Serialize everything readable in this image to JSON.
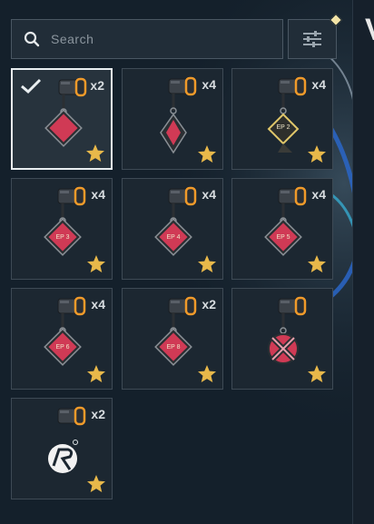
{
  "search": {
    "placeholder": "Search",
    "value": ""
  },
  "header": {
    "partial_letter": "V"
  },
  "colors": {
    "background": "#14202b",
    "card": "#1c2731",
    "card_border": "#3e4a55",
    "selected_border": "#e9eef0",
    "star": "#e8b84a",
    "charm_red": "#d03a55",
    "charm_dark": "#2b2f33",
    "filter_dot": "#f2e3a6"
  },
  "icons": {
    "search": "search-icon",
    "filter": "sliders-icon",
    "copies": "bucket-icon",
    "star": "star-icon",
    "check": "check-icon"
  },
  "items": [
    {
      "count": "x2",
      "selected": true,
      "charm": "diamond",
      "label": ""
    },
    {
      "count": "x4",
      "selected": false,
      "charm": "kite",
      "label": ""
    },
    {
      "count": "x4",
      "selected": false,
      "charm": "shield",
      "label": "EP 2"
    },
    {
      "count": "x4",
      "selected": false,
      "charm": "diamond",
      "label": "EP 3"
    },
    {
      "count": "x4",
      "selected": false,
      "charm": "diamond",
      "label": "EP 4"
    },
    {
      "count": "x4",
      "selected": false,
      "charm": "diamond",
      "label": "EP 5"
    },
    {
      "count": "x4",
      "selected": false,
      "charm": "diamond",
      "label": "EP 6"
    },
    {
      "count": "x2",
      "selected": false,
      "charm": "diamond",
      "label": "EP 8"
    },
    {
      "count": "",
      "selected": false,
      "charm": "cross",
      "label": ""
    },
    {
      "count": "x2",
      "selected": false,
      "charm": "logo",
      "label": ""
    }
  ]
}
